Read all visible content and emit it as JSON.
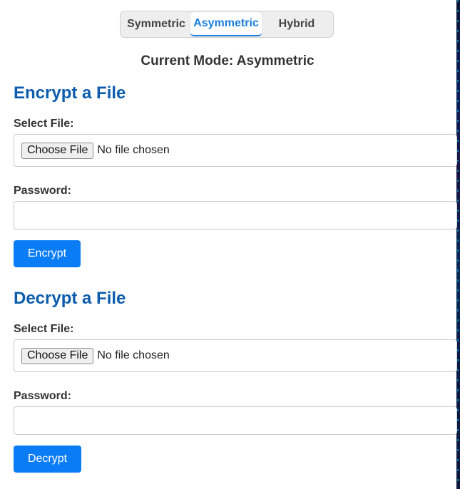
{
  "modes": {
    "items": [
      {
        "label": "Symmetric",
        "active": false
      },
      {
        "label": "Asymmetric",
        "active": true
      },
      {
        "label": "Hybrid",
        "active": false
      }
    ],
    "active_color": "#1a7fe0"
  },
  "current_mode": "Current Mode: Asymmetric",
  "encrypt": {
    "title": "Encrypt a File",
    "file_label": "Select File:",
    "choose_label": "Choose File",
    "file_status": "No file chosen",
    "password_label": "Password:",
    "password_value": "",
    "password_placeholder": "",
    "button_label": "Encrypt"
  },
  "decrypt": {
    "title": "Decrypt a File",
    "file_label": "Select File:",
    "choose_label": "Choose File",
    "file_status": "No file chosen",
    "password_label": "Password:",
    "password_value": "",
    "password_placeholder": "",
    "button_label": "Decrypt"
  },
  "colors": {
    "heading": "#0b5cad",
    "primary_button": "#0a7cf5"
  }
}
